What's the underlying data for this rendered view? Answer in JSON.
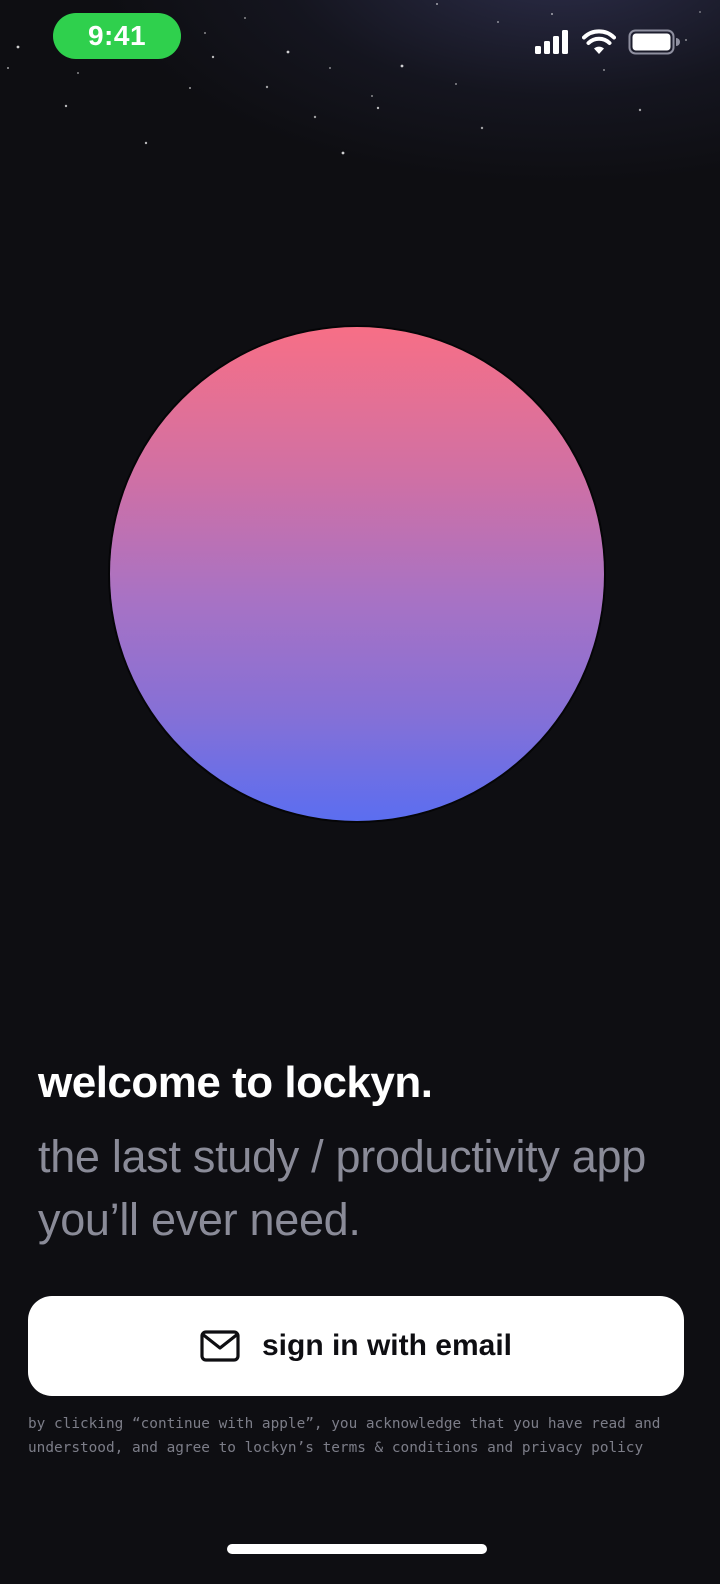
{
  "status_bar": {
    "time": "9:41",
    "time_pill_color": "#2fd04d",
    "icons": [
      "signal-icon",
      "wifi-icon",
      "battery-icon"
    ]
  },
  "hero": {
    "orb_gradient": [
      "#f76f86",
      "#a872c4",
      "#5b6ef0"
    ]
  },
  "welcome": {
    "headline": "welcome to lockyn.",
    "tagline": "the last study / productivity app you’ll ever need."
  },
  "auth": {
    "email_button_label": "sign in with email",
    "email_button_icon": "mail-icon",
    "disclaimer": "by clicking “continue with apple”, you acknowledge that you have read and understood, and agree to lockyn’s terms & conditions and privacy policy"
  },
  "colors": {
    "background": "#0e0e12",
    "headline": "#ffffff",
    "tagline": "#8a8b98",
    "disclaimer": "#7c7d88",
    "button_bg": "#ffffff"
  }
}
